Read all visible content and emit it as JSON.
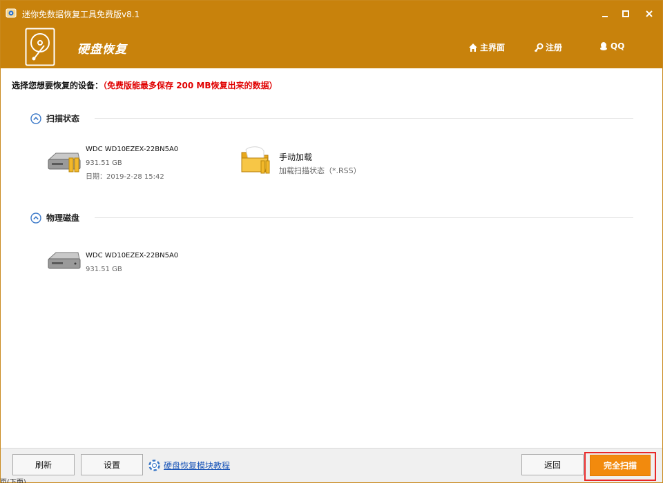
{
  "window": {
    "title": "迷你免数据恢复工具免费版v8.1",
    "app_name": "硬盘恢复"
  },
  "nav": {
    "home_label": "主界面",
    "register_label": "注册",
    "qq_label": "QQ"
  },
  "content": {
    "prompt": "选择您想要恢复的设备：",
    "prompt_note": "（免费版能最多保存 200 MB恢复出来的数据）",
    "sections": {
      "scan_status": {
        "title": "扫描状态",
        "devices": [
          {
            "name": "WDC WD10EZEX-22BN5A0",
            "size": "931.51 GB",
            "date": "日期：2019-2-28 15:42",
            "icon": "hard-drive-icon"
          },
          {
            "name": "手动加载",
            "desc": "加载扫描状态（*.RSS）",
            "icon": "folder-icon"
          }
        ]
      },
      "physical_disk": {
        "title": "物理磁盘",
        "devices": [
          {
            "name": "WDC WD10EZEX-22BN5A0",
            "size": "931.51 GB",
            "icon": "hard-drive-icon"
          }
        ]
      }
    }
  },
  "footer": {
    "refresh_label": "刷新",
    "settings_label": "设置",
    "tutorial_label": "硬盘恢复模块教程",
    "back_label": "返回",
    "fullscan_label": "完全扫描",
    "status_fragment": "页(下面)"
  },
  "colors": {
    "brand": "#c8820c",
    "accent": "#f28a0d",
    "warning_text": "#e00000",
    "highlight_frame": "#e82828",
    "link": "#1a55b8"
  }
}
